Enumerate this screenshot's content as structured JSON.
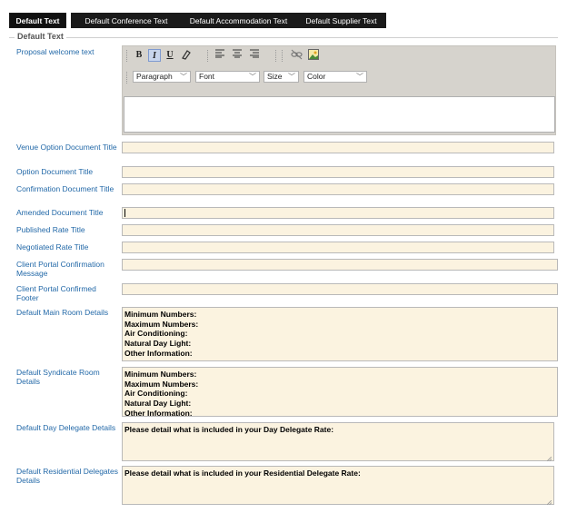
{
  "tabs": [
    {
      "label": "Default Text",
      "active": true
    },
    {
      "label": "Default Conference Text",
      "active": false
    },
    {
      "label": "Default Accommodation Text",
      "active": false
    },
    {
      "label": "Default Supplier Text",
      "active": false
    }
  ],
  "legend": "Default Text",
  "editor": {
    "label": "Proposal welcome text",
    "bold": "B",
    "italic": "I",
    "underline": "U",
    "paragraph": "Paragraph",
    "font": "Font",
    "size": "Size",
    "color": "Color"
  },
  "fields": {
    "venue_option_title": "Venue Option Document Title",
    "option_title": "Option Document Title",
    "confirmation_title": "Confirmation Document Title",
    "amended_title": "Amended Document Title",
    "published_rate": "Published Rate Title",
    "negotiated_rate": "Negotiated Rate Title",
    "client_portal_confirmation": "Client Portal Confirmation Message",
    "client_portal_footer": "Client Portal Confirmed Footer",
    "main_room": "Default Main Room Details",
    "syndicate_room": "Default Syndicate Room Details",
    "day_delegate": "Default Day Delegate Details",
    "residential": "Default Residential Delegates Details"
  },
  "room_lines": [
    "Minimum Numbers:",
    "Maximum Numbers:",
    "Air Conditioning:",
    "Natural Day Light:",
    "Other Information:"
  ],
  "day_delegate_text": "Please detail what is included in your Day Delegate Rate:",
  "residential_text": "Please detail what is included in your Residential Delegate Rate:"
}
